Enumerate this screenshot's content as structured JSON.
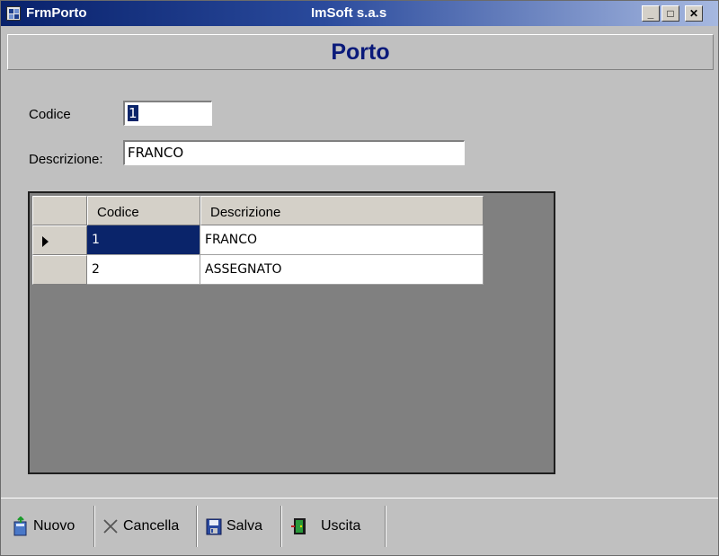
{
  "window": {
    "title": "FrmPorto",
    "company": "ImSoft s.a.s",
    "controls": {
      "minimize": "_",
      "maximize": "□",
      "close": "✕"
    }
  },
  "header": {
    "title": "Porto"
  },
  "form": {
    "codice_label": "Codice",
    "codice_value": "1",
    "descrizione_label": "Descrizione:",
    "descrizione_value": "FRANCO"
  },
  "grid": {
    "columns": [
      "Codice",
      "Descrizione"
    ],
    "rows": [
      {
        "codice": "1",
        "descrizione": "FRANCO",
        "selected": true
      },
      {
        "codice": "2",
        "descrizione": "ASSEGNATO",
        "selected": false
      }
    ]
  },
  "toolbar": {
    "nuovo_label": "Nuovo",
    "cancella_label": "Cancella",
    "salva_label": "Salva",
    "uscita_label": "Uscita"
  },
  "colors": {
    "titlebar": "#08216b",
    "header_text": "#0a1a7a",
    "selection": "#0a246a",
    "grid_background": "#808080"
  }
}
